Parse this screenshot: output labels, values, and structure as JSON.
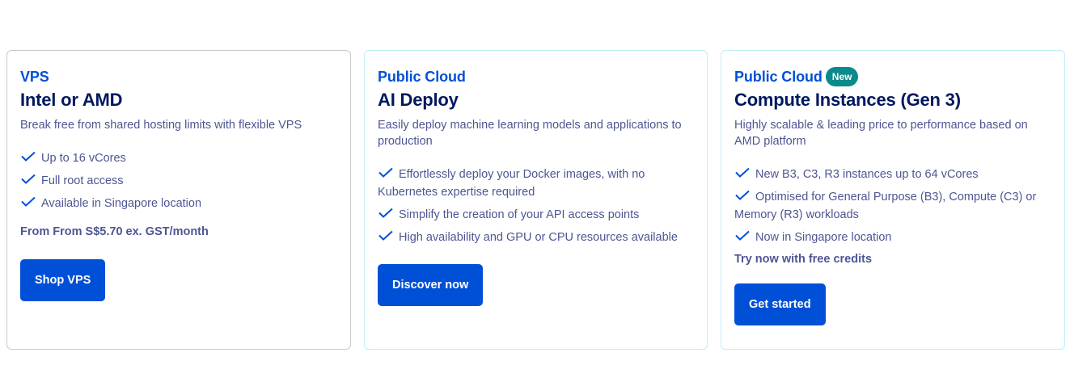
{
  "cards": [
    {
      "category": "VPS",
      "badge": "",
      "title": "Intel or AMD",
      "description": "Break free from shared hosting limits with flexible VPS",
      "features": [
        "Up to 16 vCores",
        "Full root access",
        "Available in Singapore location"
      ],
      "price": "From From S$5.70 ex. GST/month",
      "button": "Shop VPS"
    },
    {
      "category": "Public Cloud",
      "badge": "",
      "title": "AI Deploy",
      "description": "Easily deploy machine learning models and applications to production",
      "features": [
        "Effortlessly deploy your Docker images, with no Kubernetes expertise required",
        "Simplify the creation of your API access points",
        "High availability and GPU or CPU resources available"
      ],
      "price": "",
      "button": "Discover now"
    },
    {
      "category": "Public Cloud",
      "badge": "New",
      "title": "Compute Instances (Gen 3)",
      "description": "Highly scalable & leading price to performance based on AMD platform",
      "features": [
        "New B3, C3, R3 instances up to 64 vCores",
        "Optimised for General Purpose (B3), Compute (C3) or Memory (R3) workloads",
        "Now in Singapore location"
      ],
      "price": "Try now with free credits",
      "button": "Get started"
    }
  ],
  "icons": {
    "feature": "check-icon"
  },
  "colors": {
    "accent": "#0050d7",
    "title": "#00185e",
    "text": "#4d5693",
    "badge": "#0a8a8a"
  }
}
